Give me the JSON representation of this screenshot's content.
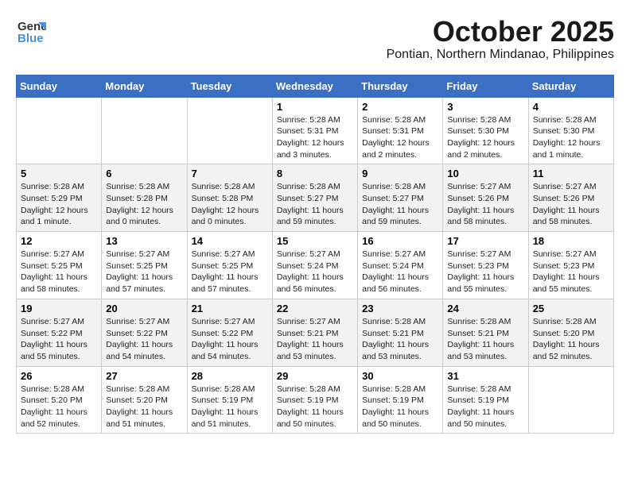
{
  "header": {
    "logo_general": "General",
    "logo_blue": "Blue",
    "month": "October 2025",
    "location": "Pontian, Northern Mindanao, Philippines"
  },
  "weekdays": [
    "Sunday",
    "Monday",
    "Tuesday",
    "Wednesday",
    "Thursday",
    "Friday",
    "Saturday"
  ],
  "weeks": [
    [
      {
        "day": "",
        "info": ""
      },
      {
        "day": "",
        "info": ""
      },
      {
        "day": "",
        "info": ""
      },
      {
        "day": "1",
        "info": "Sunrise: 5:28 AM\nSunset: 5:31 PM\nDaylight: 12 hours and 3 minutes."
      },
      {
        "day": "2",
        "info": "Sunrise: 5:28 AM\nSunset: 5:31 PM\nDaylight: 12 hours and 2 minutes."
      },
      {
        "day": "3",
        "info": "Sunrise: 5:28 AM\nSunset: 5:30 PM\nDaylight: 12 hours and 2 minutes."
      },
      {
        "day": "4",
        "info": "Sunrise: 5:28 AM\nSunset: 5:30 PM\nDaylight: 12 hours and 1 minute."
      }
    ],
    [
      {
        "day": "5",
        "info": "Sunrise: 5:28 AM\nSunset: 5:29 PM\nDaylight: 12 hours and 1 minute."
      },
      {
        "day": "6",
        "info": "Sunrise: 5:28 AM\nSunset: 5:28 PM\nDaylight: 12 hours and 0 minutes."
      },
      {
        "day": "7",
        "info": "Sunrise: 5:28 AM\nSunset: 5:28 PM\nDaylight: 12 hours and 0 minutes."
      },
      {
        "day": "8",
        "info": "Sunrise: 5:28 AM\nSunset: 5:27 PM\nDaylight: 11 hours and 59 minutes."
      },
      {
        "day": "9",
        "info": "Sunrise: 5:28 AM\nSunset: 5:27 PM\nDaylight: 11 hours and 59 minutes."
      },
      {
        "day": "10",
        "info": "Sunrise: 5:27 AM\nSunset: 5:26 PM\nDaylight: 11 hours and 58 minutes."
      },
      {
        "day": "11",
        "info": "Sunrise: 5:27 AM\nSunset: 5:26 PM\nDaylight: 11 hours and 58 minutes."
      }
    ],
    [
      {
        "day": "12",
        "info": "Sunrise: 5:27 AM\nSunset: 5:25 PM\nDaylight: 11 hours and 58 minutes."
      },
      {
        "day": "13",
        "info": "Sunrise: 5:27 AM\nSunset: 5:25 PM\nDaylight: 11 hours and 57 minutes."
      },
      {
        "day": "14",
        "info": "Sunrise: 5:27 AM\nSunset: 5:25 PM\nDaylight: 11 hours and 57 minutes."
      },
      {
        "day": "15",
        "info": "Sunrise: 5:27 AM\nSunset: 5:24 PM\nDaylight: 11 hours and 56 minutes."
      },
      {
        "day": "16",
        "info": "Sunrise: 5:27 AM\nSunset: 5:24 PM\nDaylight: 11 hours and 56 minutes."
      },
      {
        "day": "17",
        "info": "Sunrise: 5:27 AM\nSunset: 5:23 PM\nDaylight: 11 hours and 55 minutes."
      },
      {
        "day": "18",
        "info": "Sunrise: 5:27 AM\nSunset: 5:23 PM\nDaylight: 11 hours and 55 minutes."
      }
    ],
    [
      {
        "day": "19",
        "info": "Sunrise: 5:27 AM\nSunset: 5:22 PM\nDaylight: 11 hours and 55 minutes."
      },
      {
        "day": "20",
        "info": "Sunrise: 5:27 AM\nSunset: 5:22 PM\nDaylight: 11 hours and 54 minutes."
      },
      {
        "day": "21",
        "info": "Sunrise: 5:27 AM\nSunset: 5:22 PM\nDaylight: 11 hours and 54 minutes."
      },
      {
        "day": "22",
        "info": "Sunrise: 5:27 AM\nSunset: 5:21 PM\nDaylight: 11 hours and 53 minutes."
      },
      {
        "day": "23",
        "info": "Sunrise: 5:28 AM\nSunset: 5:21 PM\nDaylight: 11 hours and 53 minutes."
      },
      {
        "day": "24",
        "info": "Sunrise: 5:28 AM\nSunset: 5:21 PM\nDaylight: 11 hours and 53 minutes."
      },
      {
        "day": "25",
        "info": "Sunrise: 5:28 AM\nSunset: 5:20 PM\nDaylight: 11 hours and 52 minutes."
      }
    ],
    [
      {
        "day": "26",
        "info": "Sunrise: 5:28 AM\nSunset: 5:20 PM\nDaylight: 11 hours and 52 minutes."
      },
      {
        "day": "27",
        "info": "Sunrise: 5:28 AM\nSunset: 5:20 PM\nDaylight: 11 hours and 51 minutes."
      },
      {
        "day": "28",
        "info": "Sunrise: 5:28 AM\nSunset: 5:19 PM\nDaylight: 11 hours and 51 minutes."
      },
      {
        "day": "29",
        "info": "Sunrise: 5:28 AM\nSunset: 5:19 PM\nDaylight: 11 hours and 50 minutes."
      },
      {
        "day": "30",
        "info": "Sunrise: 5:28 AM\nSunset: 5:19 PM\nDaylight: 11 hours and 50 minutes."
      },
      {
        "day": "31",
        "info": "Sunrise: 5:28 AM\nSunset: 5:19 PM\nDaylight: 11 hours and 50 minutes."
      },
      {
        "day": "",
        "info": ""
      }
    ]
  ]
}
